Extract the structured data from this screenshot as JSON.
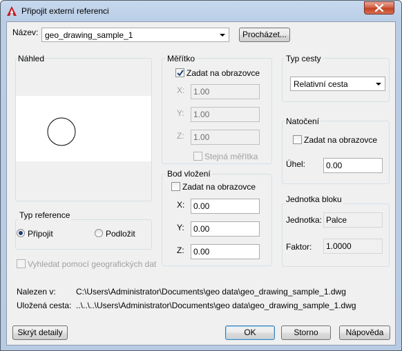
{
  "window": {
    "title": "Připojit externí referenci",
    "close_icon": "close-icon",
    "app_icon": "autocad-logo-icon"
  },
  "name_row": {
    "label": "Název:",
    "value": "geo_drawing_sample_1",
    "browse_button": "Procházet..."
  },
  "preview": {
    "title": "Náhled"
  },
  "scale": {
    "title": "Měřítko",
    "specify_on_screen": "Zadat na obrazovce",
    "specify_checked": true,
    "x_label": "X:",
    "x_value": "1.00",
    "y_label": "Y:",
    "y_value": "1.00",
    "z_label": "Z:",
    "z_value": "1.00",
    "uniform_label": "Stejná měřítka"
  },
  "path_type": {
    "title": "Typ cesty",
    "value": "Relativní cesta"
  },
  "insertion": {
    "title": "Bod vložení",
    "specify_on_screen": "Zadat na obrazovce",
    "x_label": "X:",
    "x_value": "0.00",
    "y_label": "Y:",
    "y_value": "0.00",
    "z_label": "Z:",
    "z_value": "0.00"
  },
  "rotation": {
    "title": "Natočení",
    "specify_on_screen": "Zadat na obrazovce",
    "angle_label": "Úhel:",
    "angle_value": "0.00"
  },
  "reference_type": {
    "title": "Typ reference",
    "attach_label": "Připojit",
    "overlay_label": "Podložit",
    "selected": "Připojit"
  },
  "geo_locate_label": "Vyhledat pomocí geografických dat",
  "block_unit": {
    "title": "Jednotka bloku",
    "unit_label": "Jednotka:",
    "unit_value": "Palce",
    "factor_label": "Faktor:",
    "factor_value": "1.0000"
  },
  "paths": {
    "found_in_label": "Nalezen v:",
    "found_in_value": "C:\\Users\\Administrator\\Documents\\geo data\\geo_drawing_sample_1.dwg",
    "saved_path_label": "Uložená cesta:",
    "saved_path_value": "..\\..\\..\\Users\\Administrator\\Documents\\geo data\\geo_drawing_sample_1.dwg"
  },
  "buttons": {
    "hide_details": "Skrýt detaily",
    "ok": "OK",
    "cancel": "Storno",
    "help": "Nápověda"
  }
}
